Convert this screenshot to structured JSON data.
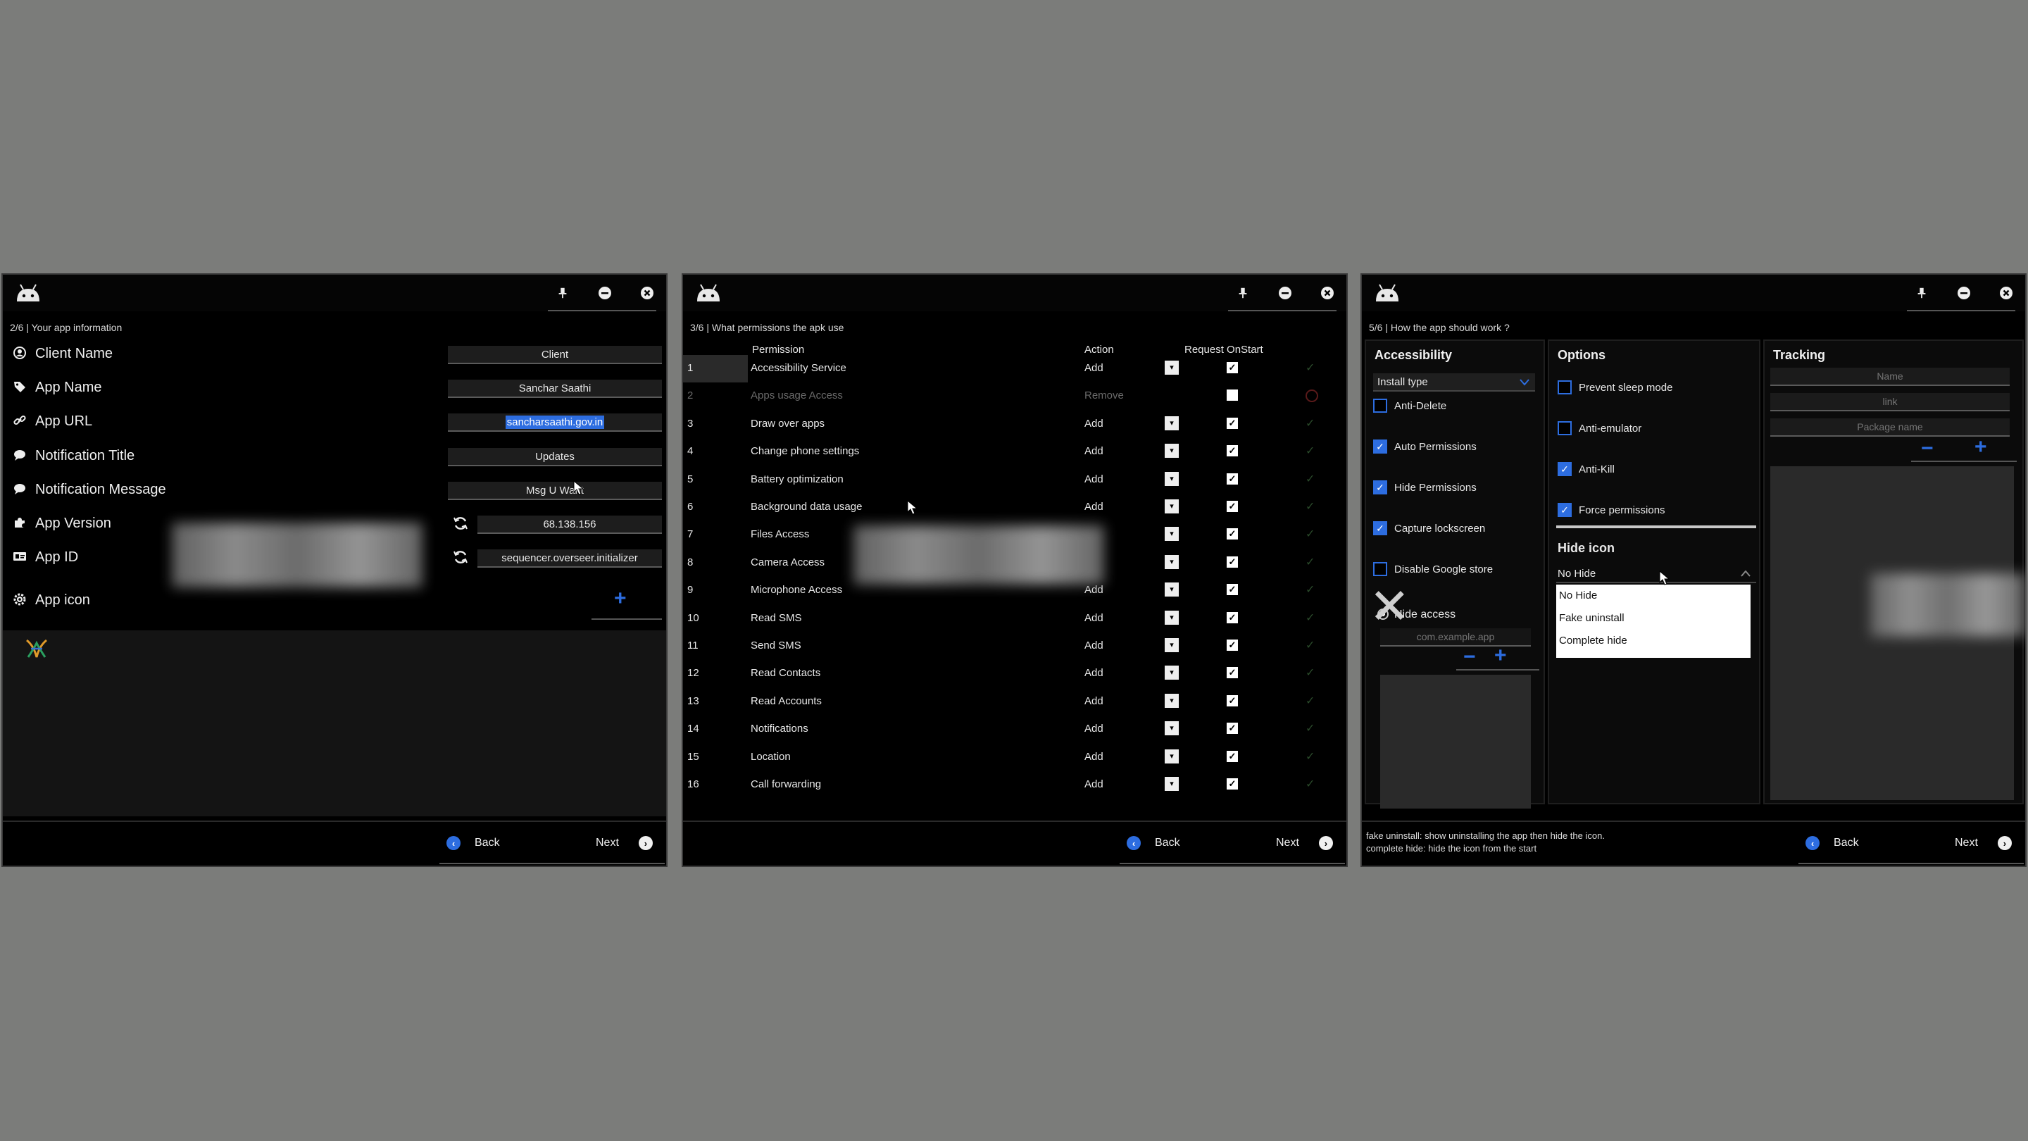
{
  "window1": {
    "step": "2/6 | Your app information",
    "fields": [
      {
        "label": "Client Name",
        "value": "Client",
        "icon": "user-circle-icon"
      },
      {
        "label": "App Name",
        "value": "Sanchar Saathi",
        "icon": "tag-icon"
      },
      {
        "label": "App URL",
        "value": "sancharsaathi.gov.in",
        "icon": "link-icon"
      },
      {
        "label": "Notification Title",
        "value": "Updates",
        "icon": "message-icon"
      },
      {
        "label": "Notification Message",
        "value": "Msg U Want",
        "icon": "message-icon"
      },
      {
        "label": "App Version",
        "value": "68.138.156",
        "icon": "puzzle-icon"
      },
      {
        "label": "App ID",
        "value": "sequencer.overseer.initializer",
        "icon": "id-card-icon"
      },
      {
        "label": "App icon",
        "icon": "gear-icon"
      }
    ],
    "back": "Back",
    "next": "Next"
  },
  "window2": {
    "step": "3/6 | What permissions the apk use",
    "headers": {
      "permission": "Permission",
      "action": "Action",
      "request": "Request OnStart"
    },
    "rows": [
      {
        "n": "1",
        "name": "Accessibility Service",
        "action": "Add"
      },
      {
        "n": "2",
        "name": "Apps usage Access",
        "action": "Remove"
      },
      {
        "n": "3",
        "name": "Draw over apps",
        "action": "Add"
      },
      {
        "n": "4",
        "name": "Change phone settings",
        "action": "Add"
      },
      {
        "n": "5",
        "name": "Battery optimization",
        "action": "Add"
      },
      {
        "n": "6",
        "name": "Background data usage",
        "action": "Add"
      },
      {
        "n": "7",
        "name": "Files Access",
        "action": ""
      },
      {
        "n": "8",
        "name": "Camera Access",
        "action": ""
      },
      {
        "n": "9",
        "name": "Microphone Access",
        "action": "Add"
      },
      {
        "n": "10",
        "name": "Read SMS",
        "action": "Add"
      },
      {
        "n": "11",
        "name": "Send SMS",
        "action": "Add"
      },
      {
        "n": "12",
        "name": "Read Contacts",
        "action": "Add"
      },
      {
        "n": "13",
        "name": "Read Accounts",
        "action": "Add"
      },
      {
        "n": "14",
        "name": "Notifications",
        "action": "Add"
      },
      {
        "n": "15",
        "name": "Location",
        "action": "Add"
      },
      {
        "n": "16",
        "name": "Call forwarding",
        "action": "Add"
      }
    ],
    "back": "Back",
    "next": "Next"
  },
  "window3": {
    "step": "5/6 | How the app should work ?",
    "accessibility": {
      "title": "Accessibility",
      "install_type": "Install type",
      "options": [
        {
          "label": "Anti-Delete",
          "checked": false
        },
        {
          "label": "Auto Permissions",
          "checked": true
        },
        {
          "label": "Hide Permissions",
          "checked": true
        },
        {
          "label": "Capture lockscreen",
          "checked": true
        },
        {
          "label": "Disable Google store",
          "checked": false
        }
      ],
      "hide_access": "Hide access",
      "package_placeholder": "com.example.app"
    },
    "options": {
      "title": "Options",
      "items": [
        {
          "label": "Prevent sleep mode",
          "checked": false
        },
        {
          "label": "Anti-emulator",
          "checked": false
        },
        {
          "label": "Anti-Kill",
          "checked": true
        },
        {
          "label": "Force permissions",
          "checked": true
        }
      ],
      "hide_icon_title": "Hide icon",
      "hide_icon_selected": "No Hide",
      "hide_icon_options": [
        "No Hide",
        "Fake uninstall",
        "Complete hide"
      ]
    },
    "tracking": {
      "title": "Tracking",
      "name_placeholder": "Name",
      "link_placeholder": "link",
      "package_placeholder": "Package name"
    },
    "hint_line1": "fake uninstall: show uninstalling the app then hide the icon.",
    "hint_line2": "complete hide: hide the icon from the start",
    "back": "Back",
    "next": "Next"
  },
  "colors": {
    "accent": "#2d6de0",
    "window_bg": "#000000",
    "desktop": "#7b7c7a"
  }
}
